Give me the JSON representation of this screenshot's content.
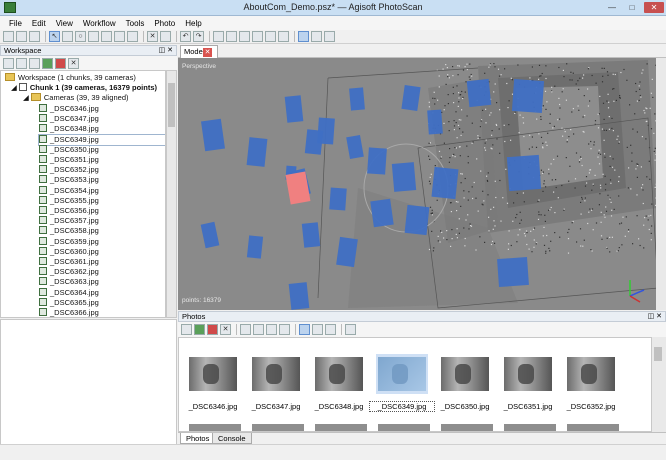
{
  "window": {
    "title": "AboutCom_Demo.psz* — Agisoft PhotoScan",
    "minimize": "—",
    "maximize": "□",
    "close": "✕"
  },
  "menu": [
    "File",
    "Edit",
    "View",
    "Workflow",
    "Tools",
    "Photo",
    "Help"
  ],
  "workspace": {
    "panel_title": "Workspace",
    "root": "Workspace (1 chunks, 39 cameras)",
    "chunk": "Chunk 1 (39 cameras, 16379 points)",
    "cameras_folder": "Cameras (39, 39 aligned)",
    "selected_camera": "_DSC6349.jpg",
    "cameras": [
      "_DSC6346.jpg",
      "_DSC6347.jpg",
      "_DSC6348.jpg",
      "_DSC6349.jpg",
      "_DSC6350.jpg",
      "_DSC6351.jpg",
      "_DSC6352.jpg",
      "_DSC6353.jpg",
      "_DSC6354.jpg",
      "_DSC6355.jpg",
      "_DSC6356.jpg",
      "_DSC6357.jpg",
      "_DSC6358.jpg",
      "_DSC6359.jpg",
      "_DSC6360.jpg",
      "_DSC6361.jpg",
      "_DSC6362.jpg",
      "_DSC6363.jpg",
      "_DSC6364.jpg",
      "_DSC6365.jpg",
      "_DSC6366.jpg"
    ]
  },
  "model": {
    "tab_label": "Model",
    "view_label": "Perspective",
    "points_label": "points: 16379",
    "colors": {
      "camera": "#3f6fc4",
      "selected_camera": "#f08080",
      "background": "#8a8a8a"
    }
  },
  "photos": {
    "panel_title": "Photos",
    "thumbnails": [
      "_DSC6346.jpg",
      "_DSC6347.jpg",
      "_DSC6348.jpg",
      "_DSC6349.jpg",
      "_DSC6350.jpg",
      "_DSC6351.jpg",
      "_DSC6352.jpg"
    ],
    "selected": "_DSC6349.jpg",
    "tabs": [
      "Photos",
      "Console"
    ]
  }
}
